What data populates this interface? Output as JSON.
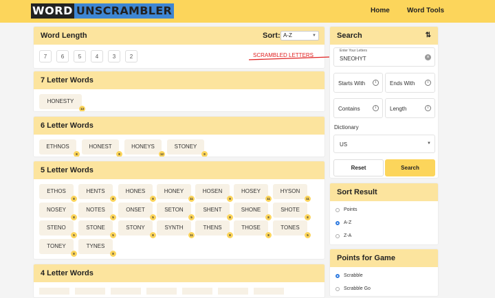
{
  "header": {
    "logo_word": "WORD",
    "logo_rest": "UNSCRAMBLER",
    "nav_home": "Home",
    "nav_tools": "Word Tools"
  },
  "wordlength": {
    "title": "Word Length",
    "sort_label": "Sort:",
    "sort_value": "A-Z",
    "lengths": [
      "7",
      "6",
      "5",
      "4",
      "3",
      "2"
    ],
    "annotation": "SCRAMBLED LETTERS"
  },
  "sections": [
    {
      "title": "7 Letter Words",
      "words": [
        {
          "w": "HONESTY",
          "p": "13"
        }
      ]
    },
    {
      "title": "6 Letter Words",
      "words": [
        {
          "w": "ETHNOS",
          "p": "8"
        },
        {
          "w": "HONEST",
          "p": "8"
        },
        {
          "w": "HONEYS",
          "p": "12"
        },
        {
          "w": "STONEY",
          "p": "9"
        }
      ]
    },
    {
      "title": "5 Letter Words",
      "words": [
        {
          "w": "ETHOS",
          "p": "8"
        },
        {
          "w": "HENTS",
          "p": "8"
        },
        {
          "w": "HONES",
          "p": "8"
        },
        {
          "w": "HONEY",
          "p": "11"
        },
        {
          "w": "HOSEN",
          "p": "8"
        },
        {
          "w": "HOSEY",
          "p": "11"
        },
        {
          "w": "HYSON",
          "p": "11"
        },
        {
          "w": "NOSEY",
          "p": "8"
        },
        {
          "w": "NOTES",
          "p": "5"
        },
        {
          "w": "ONSET",
          "p": "5"
        },
        {
          "w": "SETON",
          "p": "5"
        },
        {
          "w": "SHENT",
          "p": "8"
        },
        {
          "w": "SHONE",
          "p": "8"
        },
        {
          "w": "SHOTE",
          "p": "8"
        },
        {
          "w": "STENO",
          "p": "5"
        },
        {
          "w": "STONE",
          "p": "5"
        },
        {
          "w": "STONY",
          "p": "8"
        },
        {
          "w": "SYNTH",
          "p": "11"
        },
        {
          "w": "THENS",
          "p": "8"
        },
        {
          "w": "THOSE",
          "p": "8"
        },
        {
          "w": "TONES",
          "p": "5"
        },
        {
          "w": "TONEY",
          "p": "8"
        },
        {
          "w": "TYNES",
          "p": "8"
        }
      ]
    },
    {
      "title": "4 Letter Words",
      "words": []
    }
  ],
  "search": {
    "title": "Search",
    "sort_icon": "⇅",
    "letters_label": "Enter Your Letters",
    "letters_value": "SNEOHYT",
    "starts_with": "Starts With",
    "ends_with": "Ends With",
    "contains": "Contains",
    "length": "Length",
    "dictionary_label": "Dictionary",
    "dictionary_value": "US",
    "reset": "Reset",
    "search": "Search"
  },
  "sort_result": {
    "title": "Sort Result",
    "options": [
      "Points",
      "A-Z",
      "Z-A"
    ],
    "selected": "A-Z"
  },
  "points_for_game": {
    "title": "Points for Game",
    "options": [
      "Scrabble",
      "Scrabble Go"
    ],
    "selected": "Scrabble"
  },
  "colors": {
    "accent": "#fcd55b",
    "header_bg": "#fce49e",
    "arrow": "#e02020",
    "radio": "#2f7be0"
  }
}
